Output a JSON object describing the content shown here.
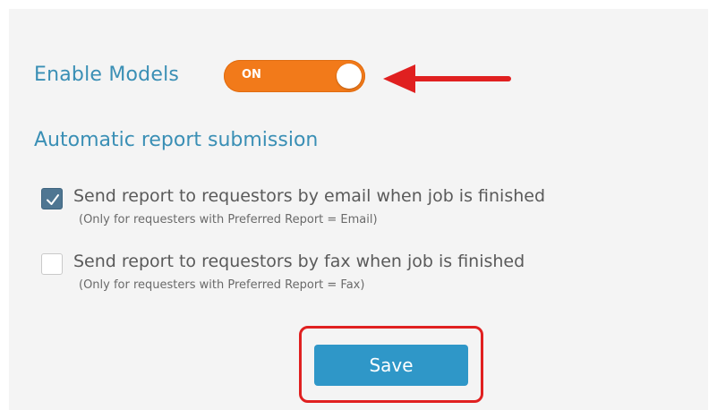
{
  "enable_models": {
    "label": "Enable Models",
    "toggle_state_label": "ON",
    "enabled": true
  },
  "automatic_report": {
    "title": "Automatic report submission",
    "options": [
      {
        "label": "Send report to requestors by email when job is finished",
        "note": "(Only for requesters with Preferred Report = Email)",
        "checked": true
      },
      {
        "label": "Send report to requestors by fax when job is finished",
        "note": "(Only for requesters with Preferred Report = Fax)",
        "checked": false
      }
    ]
  },
  "actions": {
    "save_label": "Save"
  },
  "colors": {
    "accent_text": "#3a8fb5",
    "toggle_on": "#f27a1a",
    "checkbox_checked": "#4f7692",
    "save_button": "#2f97c8",
    "annotation_red": "#e02020"
  },
  "icons": {
    "annotation_arrow": "left-arrow-icon",
    "check": "checkmark-icon"
  }
}
